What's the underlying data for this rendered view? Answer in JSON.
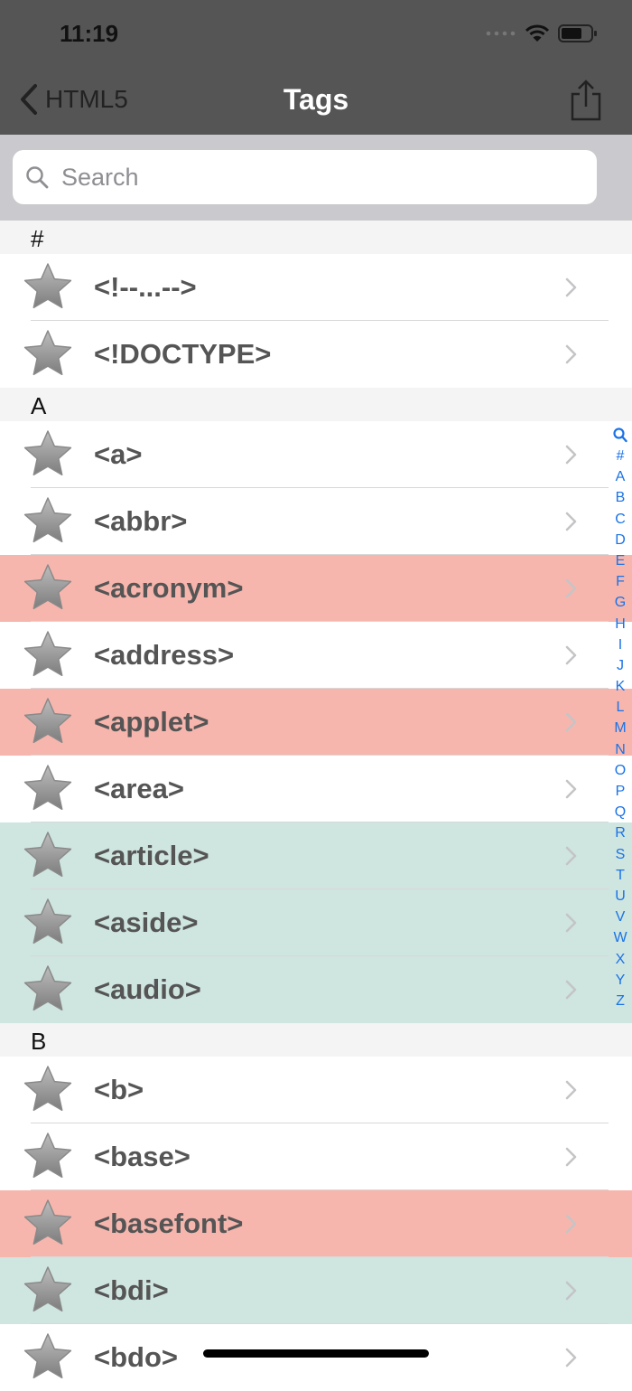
{
  "status_bar": {
    "time": "11:19"
  },
  "nav": {
    "back_label": "HTML5",
    "title": "Tags"
  },
  "search": {
    "placeholder": "Search"
  },
  "sections": [
    {
      "header": "#",
      "rows": [
        {
          "label": "<!--...-->",
          "status": "normal"
        },
        {
          "label": "<!DOCTYPE>",
          "status": "normal"
        }
      ]
    },
    {
      "header": "A",
      "rows": [
        {
          "label": "<a>",
          "status": "normal"
        },
        {
          "label": "<abbr>",
          "status": "normal"
        },
        {
          "label": "<acronym>",
          "status": "deprecated"
        },
        {
          "label": "<address>",
          "status": "normal"
        },
        {
          "label": "<applet>",
          "status": "deprecated"
        },
        {
          "label": "<area>",
          "status": "normal"
        },
        {
          "label": "<article>",
          "status": "html5"
        },
        {
          "label": "<aside>",
          "status": "html5"
        },
        {
          "label": "<audio>",
          "status": "html5"
        }
      ]
    },
    {
      "header": "B",
      "rows": [
        {
          "label": "<b>",
          "status": "normal"
        },
        {
          "label": "<base>",
          "status": "normal"
        },
        {
          "label": "<basefont>",
          "status": "deprecated"
        },
        {
          "label": "<bdi>",
          "status": "html5"
        },
        {
          "label": "<bdo>",
          "status": "normal"
        }
      ]
    }
  ],
  "index_letters": [
    "#",
    "A",
    "B",
    "C",
    "D",
    "E",
    "F",
    "G",
    "H",
    "I",
    "J",
    "K",
    "L",
    "M",
    "N",
    "O",
    "P",
    "Q",
    "R",
    "S",
    "T",
    "U",
    "V",
    "W",
    "X",
    "Y",
    "Z"
  ],
  "colors": {
    "deprecated": "#f7b6ad",
    "html5": "#cfe5df",
    "index": "#1a73e8",
    "nav_bar": "#555555"
  },
  "icons": {
    "row_icon": "star-icon",
    "row_disclosure": "chevron-right-icon",
    "share": "share-icon",
    "back": "chevron-left-icon",
    "search": "search-icon"
  }
}
